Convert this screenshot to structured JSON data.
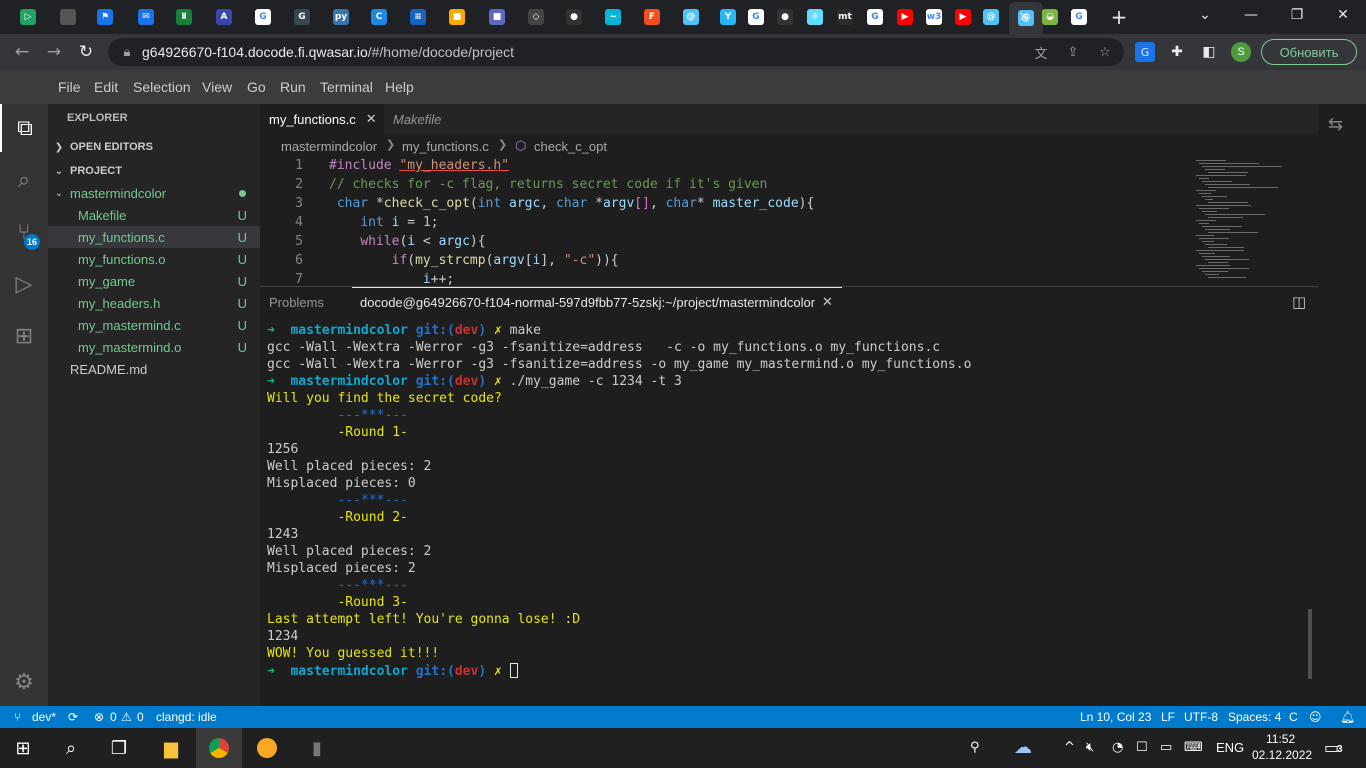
{
  "browser": {
    "tabs": [
      {
        "icon": "play-code-icon",
        "glyph": "▷",
        "color": "#21a366"
      },
      {
        "icon": "apple-icon",
        "glyph": "",
        "color": "#555555"
      },
      {
        "icon": "flag-icon",
        "glyph": "⚑",
        "color": "#1a73e8"
      },
      {
        "icon": "mail-icon",
        "glyph": "✉",
        "color": "#1a73e8"
      },
      {
        "icon": "castle-icon",
        "glyph": "♜",
        "color": "#188038"
      },
      {
        "icon": "angular-icon",
        "glyph": "A",
        "color": "#3949ab"
      },
      {
        "icon": "google-icon",
        "glyph": "G",
        "color": "#ffffff"
      },
      {
        "icon": "doc-icon",
        "glyph": "G",
        "color": "#37474f"
      },
      {
        "icon": "python-icon",
        "glyph": "py",
        "color": "#3776ab"
      },
      {
        "icon": "chrome-c-icon",
        "glyph": "C",
        "color": "#1e88e5"
      },
      {
        "icon": "stack-icon",
        "glyph": "≡",
        "color": "#1565c0"
      },
      {
        "icon": "notes-icon",
        "glyph": "■",
        "color": "#f9ab00"
      },
      {
        "icon": "app-icon",
        "glyph": "■",
        "color": "#5c6bc0"
      },
      {
        "icon": "codepen-icon",
        "glyph": "◇",
        "color": "#444444"
      },
      {
        "icon": "github-icon",
        "glyph": "●",
        "color": "#333333"
      },
      {
        "icon": "tailwind-icon",
        "glyph": "~",
        "color": "#06b6d4"
      },
      {
        "icon": "figma-icon",
        "glyph": "F",
        "color": "#f24e1e"
      },
      {
        "icon": "spiral-icon",
        "glyph": "@",
        "color": "#4fc3f7"
      },
      {
        "icon": "bird-icon",
        "glyph": "Y",
        "color": "#29b6f6"
      },
      {
        "icon": "google-icon",
        "glyph": "G",
        "color": "#ffffff"
      },
      {
        "icon": "github-icon",
        "glyph": "●",
        "color": "#333333"
      },
      {
        "icon": "react-icon",
        "glyph": "⚛",
        "color": "#61dafb"
      },
      {
        "icon": "mt-icon",
        "glyph": "mt",
        "color": "#2b2b2b"
      },
      {
        "icon": "google-icon",
        "glyph": "G",
        "color": "#ffffff"
      },
      {
        "icon": "youtube-icon",
        "glyph": "▶",
        "color": "#ff0000"
      },
      {
        "icon": "w3schools-icon",
        "glyph": "w3",
        "color": "#ffffff"
      },
      {
        "icon": "youtube-icon",
        "glyph": "▶",
        "color": "#ff0000"
      },
      {
        "icon": "spiral-icon",
        "glyph": "@",
        "color": "#4fc3f7"
      },
      {
        "icon": "spiral-icon",
        "glyph": "@",
        "color": "#4fc3f7"
      },
      {
        "icon": "android-icon",
        "glyph": "◒",
        "color": "#7cb342"
      },
      {
        "icon": "google-icon",
        "glyph": "G",
        "color": "#ffffff"
      }
    ],
    "url_host": "g64926670-f104.docode.fi.qwasar.io",
    "url_path": "/#/home/docode/project",
    "profile_initial": "S",
    "update_label": "Обновить"
  },
  "menubar": [
    "File",
    "Edit",
    "Selection",
    "View",
    "Go",
    "Run",
    "Terminal",
    "Help"
  ],
  "activity": {
    "scm_badge": "16"
  },
  "explorer": {
    "title": "EXPLORER",
    "open_editors": "OPEN EDITORS",
    "project": "PROJECT",
    "folder": "mastermindcolor",
    "files": [
      {
        "name": "Makefile",
        "status": "U"
      },
      {
        "name": "my_functions.c",
        "status": "U"
      },
      {
        "name": "my_functions.o",
        "status": "U"
      },
      {
        "name": "my_game",
        "status": "U"
      },
      {
        "name": "my_headers.h",
        "status": "U"
      },
      {
        "name": "my_mastermind.c",
        "status": "U"
      },
      {
        "name": "my_mastermind.o",
        "status": "U"
      }
    ],
    "readme": "README.md"
  },
  "editor": {
    "tabs": [
      {
        "label": "my_functions.c",
        "close": "✕"
      },
      {
        "label": "Makefile"
      }
    ],
    "breadcrumbs": [
      "mastermindcolor",
      "my_functions.c",
      "check_c_opt"
    ],
    "lines": [
      {
        "n": "1",
        "html": "<span style='color:#c586c0'>#include</span> <span style='color:#ce9178;text-decoration:underline;text-decoration-color:#f14c4c'>\"my_headers.h\"</span>"
      },
      {
        "n": "2",
        "html": "<span style='color:#6a9955'>// checks for -c flag, returns secret code if it's given</span>"
      },
      {
        "n": "3",
        "html": " <span style='color:#569cd6'>char</span> *<span style='color:#dcdcaa'>check_c_opt</span>(<span style='color:#569cd6'>int</span> <span style='color:#9cdcfe'>argc</span>, <span style='color:#569cd6'>char</span> *<span style='color:#9cdcfe'>argv</span><span style='color:#da70d6'>[]</span>, <span style='color:#569cd6'>char</span>* <span style='color:#9cdcfe'>master_code</span>){"
      },
      {
        "n": "4",
        "html": "    <span style='color:#569cd6'>int</span> <span style='color:#9cdcfe'>i</span> = <span style='color:#b5cea8'>1</span>;"
      },
      {
        "n": "5",
        "html": "    <span style='color:#c586c0'>while</span>(<span style='color:#9cdcfe'>i</span> &lt; <span style='color:#9cdcfe'>argc</span>){"
      },
      {
        "n": "6",
        "html": "        <span style='color:#c586c0'>if</span>(<span style='color:#dcdcaa'>my_strcmp</span>(<span style='color:#9cdcfe'>argv</span>[<span style='color:#9cdcfe'>i</span>], <span style='color:#ce9178'>\"-c\"</span>)){"
      },
      {
        "n": "7",
        "html": "            <span style='color:#9cdcfe'>i</span>++;"
      }
    ]
  },
  "panel": {
    "problems_tab": "Problems",
    "terminal_tab": "docode@g64926670-f104-normal-597d9fbb77-5zskj:~/project/mastermindcolor",
    "close": "✕",
    "lines": [
      "<span style='color:#0dbc79;font-weight:bold'>➜</span>  <span style='color:#11a8cd;font-weight:bold'>mastermindcolor</span> <span style='color:#2472c8;font-weight:bold'>git:(</span><span style='color:#cd3131;font-weight:bold'>dev</span><span style='color:#2472c8;font-weight:bold'>)</span> <span style='color:#e5e510;font-weight:bold'>✗</span> make",
      "gcc -Wall -Wextra -Werror -g3 -fsanitize=address   -c -o my_functions.o my_functions.c",
      "gcc -Wall -Wextra -Werror -g3 -fsanitize=address -o my_game my_mastermind.o my_functions.o",
      "<span style='color:#0dbc79;font-weight:bold'>➜</span>  <span style='color:#11a8cd;font-weight:bold'>mastermindcolor</span> <span style='color:#2472c8;font-weight:bold'>git:(</span><span style='color:#cd3131;font-weight:bold'>dev</span><span style='color:#2472c8;font-weight:bold'>)</span> <span style='color:#e5e510;font-weight:bold'>✗</span> ./my_game -c 1234 -t 3",
      "<span style='color:#e5e510'>Will you find the secret code?</span>",
      "<span style='color:#2472c8'>         ---***---</span>",
      "<span style='color:#e5e510'>         -Round 1-</span>",
      "1256",
      "Well placed pieces: 2",
      "Misplaced pieces: 0",
      "<span style='color:#2472c8'>         ---***---</span>",
      "<span style='color:#e5e510'>         -Round 2-</span>",
      "1243",
      "Well placed pieces: 2",
      "Misplaced pieces: 2",
      "<span style='color:#2472c8'>         ---***---</span>",
      "<span style='color:#e5e510'>         -Round 3-</span>",
      "<span style='color:#e5e510'>Last attempt left! You're gonna lose! :D</span>",
      "1234",
      "<span style='color:#e5e510'>WOW! You guessed it!!!</span>",
      "<span style='color:#0dbc79;font-weight:bold'>➜</span>  <span style='color:#11a8cd;font-weight:bold'>mastermindcolor</span> <span style='color:#2472c8;font-weight:bold'>git:(</span><span style='color:#cd3131;font-weight:bold'>dev</span><span style='color:#2472c8;font-weight:bold'>)</span> <span style='color:#e5e510;font-weight:bold'>✗</span> <span class='cursor'></span>"
    ]
  },
  "statusbar": {
    "branch": "dev*",
    "errors": "0",
    "warnings": "0",
    "clangd": "clangd: idle",
    "position": "Ln 10, Col 23",
    "eol": "LF",
    "encoding": "UTF-8",
    "indent": "Spaces: 4",
    "language": "C"
  },
  "taskbar": {
    "lang": "ENG",
    "time": "11:52",
    "date": "02.12.2022",
    "notifications": "3"
  }
}
